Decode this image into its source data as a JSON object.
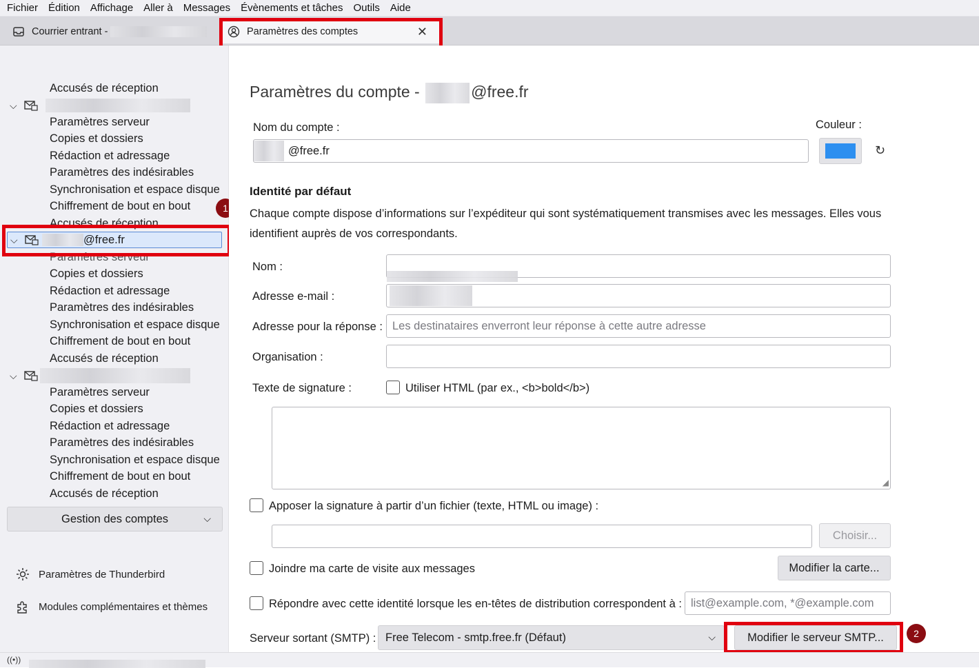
{
  "menu": {
    "items": [
      "Fichier",
      "Édition",
      "Affichage",
      "Aller à",
      "Messages",
      "Évènements et tâches",
      "Outils",
      "Aide"
    ]
  },
  "tabs": {
    "inbox_label": "Courrier entrant -",
    "settings_label": "Paramètres des comptes",
    "close_symbol": "✕"
  },
  "sidebar": {
    "top_item": "Accusés de réception",
    "account1_items": [
      "Paramètres serveur",
      "Copies et dossiers",
      "Rédaction et adressage",
      "Paramètres des indésirables",
      "Synchronisation et espace disque",
      "Chiffrement de bout en bout",
      "Accusés de réception"
    ],
    "selected_account": "@free.fr",
    "account2_items": [
      "Paramètres serveur",
      "Copies et dossiers",
      "Rédaction et adressage",
      "Paramètres des indésirables",
      "Synchronisation et espace disque",
      "Chiffrement de bout en bout",
      "Accusés de réception"
    ],
    "account3_items": [
      "Paramètres serveur",
      "Copies et dossiers",
      "Rédaction et adressage",
      "Paramètres des indésirables",
      "Synchronisation et espace disque",
      "Chiffrement de bout en bout",
      "Accusés de réception"
    ],
    "manage_button": "Gestion des comptes",
    "thunderbird_settings": "Paramètres de Thunderbird",
    "addons": "Modules complémentaires et thèmes",
    "badge1": "1"
  },
  "main": {
    "title_prefix": "Paramètres du compte -",
    "title_domain": "@free.fr",
    "account_name_label": "Nom du compte :",
    "account_name_value": "@free.fr",
    "color_label": "Couleur :",
    "color_value": "#2d8ff0",
    "identity_heading": "Identité par défaut",
    "identity_desc_line1": "Chaque compte dispose d’informations sur l’expéditeur qui sont systématiquement transmises avec les messages. Elles vous",
    "identity_desc_line2": "identifient auprès de vos correspondants.",
    "name_label": "Nom :",
    "email_label": "Adresse e-mail :",
    "reply_label": "Adresse pour la réponse :",
    "reply_placeholder": "Les destinataires enverront leur réponse à cette autre adresse",
    "org_label": "Organisation :",
    "signature_label": "Texte de signature :",
    "use_html_label": "Utiliser HTML (par ex., <b>bold</b>)",
    "attach_sig_label": "Apposer la signature à partir d’un fichier (texte, HTML ou image) :",
    "choose_button": "Choisir...",
    "vcard_label": "Joindre ma carte de visite aux messages",
    "edit_card_button": "Modifier la carte...",
    "reply_identity_label": "Répondre avec cette identité lorsque les en-têtes de distribution correspondent à :",
    "reply_identity_placeholder": "list@example.com, *@example.com",
    "smtp_label": "Serveur sortant (SMTP) :",
    "smtp_value": "Free Telecom - smtp.free.fr (Défaut)",
    "smtp_button": "Modifier le serveur SMTP...",
    "badge2": "2"
  }
}
